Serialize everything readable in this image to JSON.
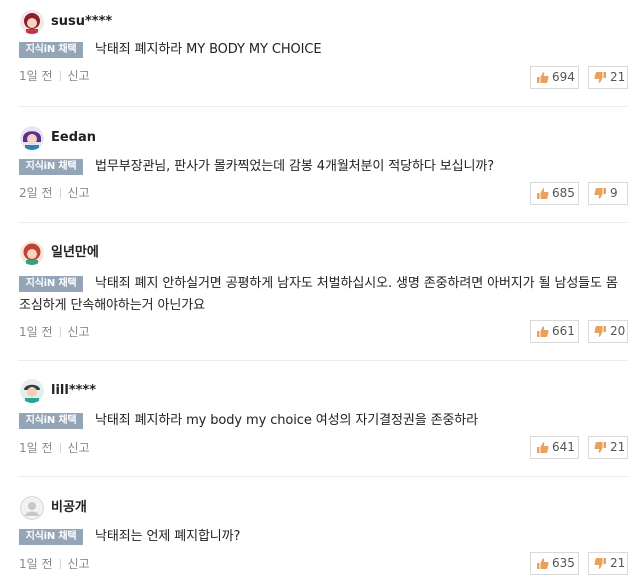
{
  "badge_label": "지식iN 채택",
  "report_label": "신고",
  "comments": [
    {
      "user": "susu****",
      "text": "낙태죄 폐지하라 MY BODY MY CHOICE",
      "time": "1일 전",
      "likes": "694",
      "dislikes": "21",
      "avatar": "girl-red-avatar"
    },
    {
      "user": "Eedan",
      "text": "법무부장관님, 판사가 몰카찍었는데 감봉 4개월처분이 적당하다 보십니까?",
      "time": "2일 전",
      "likes": "685",
      "dislikes": "9",
      "avatar": "purple-hair-avatar"
    },
    {
      "user": "일년만에",
      "text": "낙태죄 폐지 안하실거면 공평하게 남자도 처벌하십시오. 생명 존중하려면 아버지가 될 남성들도 몸 조심하게 단속해야하는거 아닌가요",
      "time": "1일 전",
      "likes": "661",
      "dislikes": "20",
      "avatar": "girl-curly-avatar"
    },
    {
      "user": "lill****",
      "text": "낙태죄 폐지하라 my body my choice 여성의 자기결정권을 존중하라",
      "time": "1일 전",
      "likes": "641",
      "dislikes": "21",
      "avatar": "boy-teal-avatar"
    },
    {
      "user": "비공개",
      "text": "낙태죄는 언제 폐지합니까?",
      "time": "1일 전",
      "likes": "635",
      "dislikes": "21",
      "avatar": "default-avatar"
    }
  ]
}
